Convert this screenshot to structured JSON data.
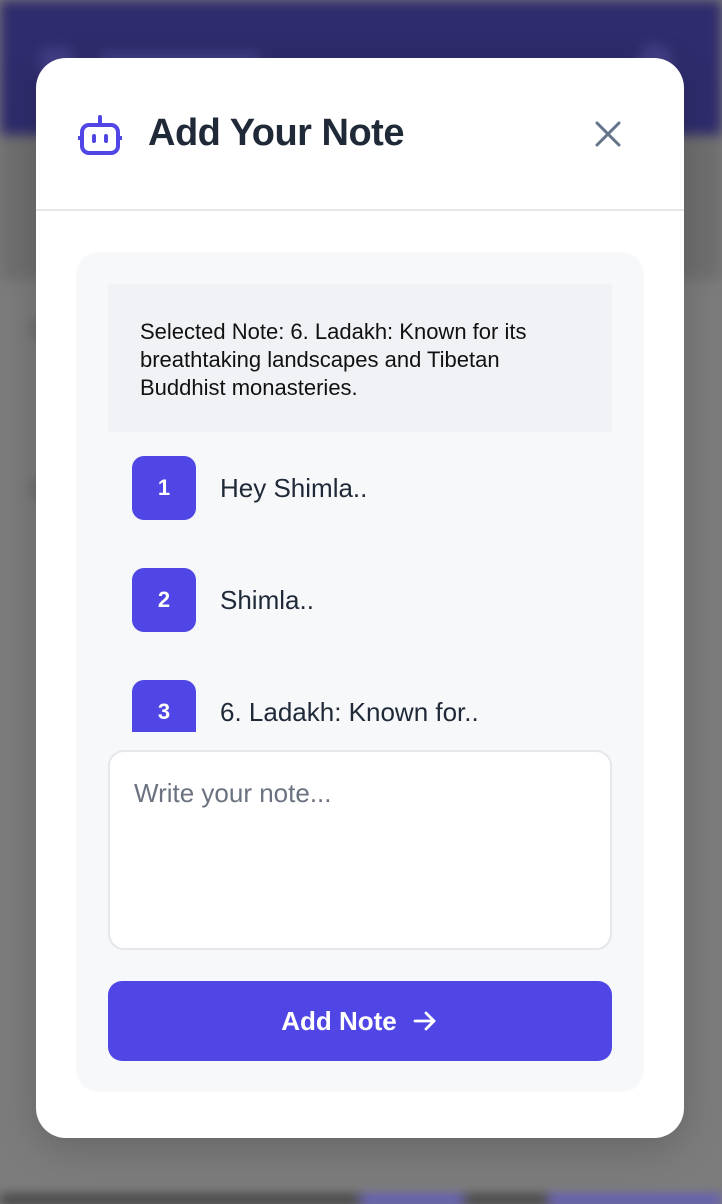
{
  "modal": {
    "title": "Add Your Note",
    "header_icon": "robot-icon",
    "close_icon": "close-icon",
    "selected_note": "Selected Note: 6. Ladakh: Known for its breathtaking landscapes and Tibetan Buddhist monasteries.",
    "notes": [
      {
        "number": "1",
        "text": "Hey Shimla.."
      },
      {
        "number": "2",
        "text": "Shimla.."
      },
      {
        "number": "3",
        "text": "6. Ladakh: Known for.."
      }
    ],
    "input": {
      "placeholder": "Write your note...",
      "value": ""
    },
    "add_button": {
      "label": "Add Note",
      "icon": "arrow-right-icon"
    }
  },
  "colors": {
    "accent": "#4f46e5",
    "header_bg": "#25216b",
    "title": "#1f2937"
  }
}
